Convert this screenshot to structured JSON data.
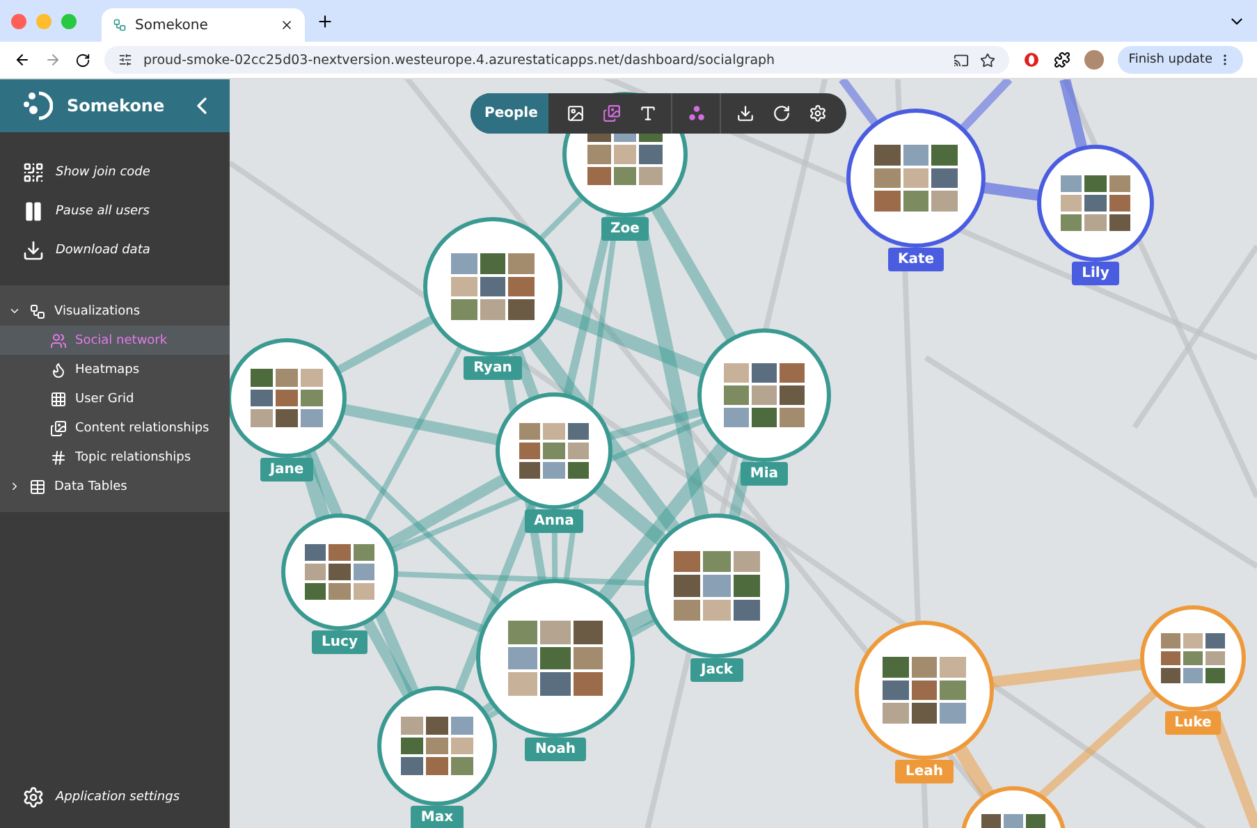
{
  "browser": {
    "tab_title": "Somekone",
    "url": "proud-smoke-02cc25d03-nextversion.westeurope.4.azurestaticapps.net/dashboard/socialgraph",
    "update_button": "Finish update"
  },
  "sidebar": {
    "app_name": "Somekone",
    "actions": [
      {
        "kind": "qr",
        "label": "Show join code"
      },
      {
        "kind": "pause",
        "label": "Pause all users"
      },
      {
        "kind": "download",
        "label": "Download data"
      }
    ],
    "tree": [
      {
        "kind": "visual",
        "label": "Visualizations",
        "expanded": true,
        "selected": false,
        "children": [
          {
            "kind": "people",
            "label": "Social network",
            "selected": true
          },
          {
            "kind": "flame",
            "label": "Heatmaps",
            "selected": false
          },
          {
            "kind": "grid",
            "label": "User Grid",
            "selected": false
          },
          {
            "kind": "images",
            "label": "Content relationships",
            "selected": false
          },
          {
            "kind": "hash",
            "label": "Topic relationships",
            "selected": false
          }
        ]
      },
      {
        "kind": "table",
        "label": "Data Tables",
        "expanded": false,
        "selected": false
      }
    ],
    "settings": "Application settings"
  },
  "toolbar": {
    "mode": "People",
    "tools": [
      {
        "kind": "image",
        "active": false
      },
      {
        "kind": "images",
        "active": true
      },
      {
        "kind": "text",
        "active": false
      },
      {
        "kind": "cluster",
        "active": true
      },
      {
        "kind": "download",
        "active": false
      },
      {
        "kind": "refresh",
        "active": false
      },
      {
        "kind": "settings",
        "active": false
      }
    ]
  },
  "graph": {
    "nodes": [
      {
        "name": "Zoe",
        "color": "#3a9a92"
      },
      {
        "name": "Ryan",
        "color": "#3a9a92"
      },
      {
        "name": "Jane",
        "color": "#3a9a92"
      },
      {
        "name": "Anna",
        "color": "#3a9a92"
      },
      {
        "name": "Mia",
        "color": "#3a9a92"
      },
      {
        "name": "Lucy",
        "color": "#3a9a92"
      },
      {
        "name": "Jack",
        "color": "#3a9a92"
      },
      {
        "name": "Noah",
        "color": "#3a9a92"
      },
      {
        "name": "Max",
        "color": "#3a9a92"
      },
      {
        "name": "Kate",
        "color": "#4a5de0"
      },
      {
        "name": "Lily",
        "color": "#4a5de0"
      },
      {
        "name": "Leah",
        "color": "#ee9a3a"
      },
      {
        "name": "Luke",
        "color": "#ee9a3a"
      }
    ]
  }
}
